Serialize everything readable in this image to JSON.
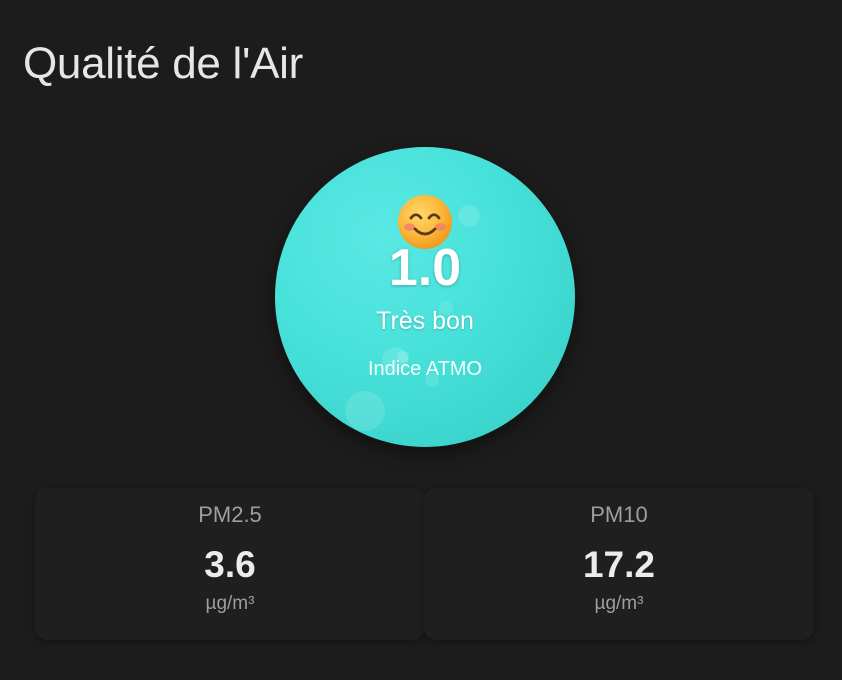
{
  "card": {
    "title": "Qualité de l'Air"
  },
  "aqi": {
    "icon": "smiling-face-icon",
    "value": "1.0",
    "level": "Très bon",
    "subtitle": "Indice ATMO",
    "color": "#48e2da"
  },
  "pollutants": [
    {
      "label": "PM2.5",
      "value": "3.6",
      "unit": "µg/m³"
    },
    {
      "label": "PM10",
      "value": "17.2",
      "unit": "µg/m³"
    }
  ]
}
